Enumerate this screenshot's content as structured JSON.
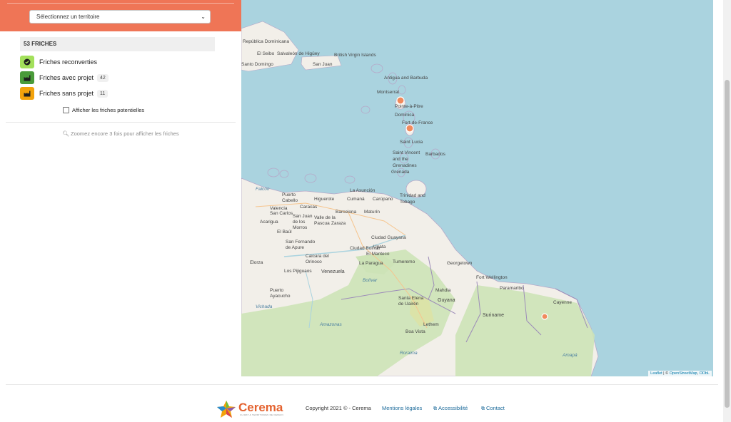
{
  "sidebar": {
    "territory_select": {
      "value": "Sélectionnez un territoire"
    },
    "count_header": "53 FRICHES",
    "legend": [
      {
        "label": "Friches reconverties",
        "badge": null,
        "color": "#a3e05b",
        "icon": "check-circle-icon"
      },
      {
        "label": "Friches avec projet",
        "badge": "42",
        "color": "#4a9b3a",
        "icon": "factory-icon"
      },
      {
        "label": "Friches sans projet",
        "badge": "11",
        "color": "#f2a20b",
        "icon": "factory-icon"
      }
    ],
    "potential_checkbox": {
      "label": "Afficher les friches potentielles",
      "checked": false
    },
    "zoom_message": "Zoomez encore 3 fois pour afficher les friches",
    "accent_color": "#ef7556"
  },
  "map": {
    "attribution": {
      "leaflet": "Leaflet",
      "separator": " | © ",
      "osm": "OpenStreetMap",
      "odbl": "ODbL"
    },
    "places": {
      "republica_dominicana": "República Dominicana",
      "el_seibo": "El Seibo",
      "salvaleon_de_higuey": "Salvaleón de Higüey",
      "santo_domingo": "Santo Domingo",
      "san_juan": "San Juan",
      "british_virgin_islands": "British Virgin Islands",
      "antigua_and_barbuda": "Antigua and Barbuda",
      "montserrat": "Montserrat",
      "pointe_a_pitre": "Pointe-à-Pitre",
      "dominica": "Dominica",
      "fort_de_france": "Fort-de-France",
      "saint_lucia": "Saint Lucia",
      "barbados": "Barbados",
      "saint_vincent": "Saint Vincent and the Grenadines",
      "grenada": "Grenada",
      "trinidad_and_tobago": "Trinidad and Tobago",
      "caracas": "Caracas",
      "valencia": "Valencia",
      "barcelona": "Barcelona",
      "maturin": "Maturín",
      "cumana": "Cumaná",
      "ciudad_guayana": "Ciudad Guayana",
      "ciudad_bolivar": "Ciudad Bolívar",
      "san_fernando_de_apure": "San Fernando de Apure",
      "georgetown": "Georgetown",
      "paramaribo": "Paramaribo",
      "cayenne": "Cayenne",
      "venezuela": "Venezuela",
      "guyana": "Guyana",
      "suriname": "Suriname",
      "boa_vista": "Boa Vista",
      "santa_elena_de_uairen": "Santa Elena de Uairén",
      "puerto_ayacucho": "Puerto Ayacucho",
      "lethem": "Lethem",
      "new_amsterdam": "New Amsterdam",
      "fort_wellington": "Fort Wellington",
      "linden": "Linden",
      "mahdia": "Mahdia",
      "la_asuncion": "La Asunción",
      "carupano": "Carúpano",
      "upata": "Upata",
      "el_manteco": "El Manteco",
      "la_paragua": "La Paragua",
      "tumeremo": "Tumeremo",
      "caicara_del_orinoco": "Caicara del Orinoco",
      "los_pijiguaos": "Los Pijiguaos",
      "elorza": "Elorza",
      "el_baul": "El Baúl",
      "acarigua": "Acarigua",
      "san_carlos": "San Carlos",
      "san_juan_de_los_morros": "San Juan de los Morros",
      "zaraza": "Zaraza",
      "valle_de_la_pascua": "Valle de la Pascua",
      "higuerote": "Higuerote",
      "puerto_cabello": "Puerto Cabello",
      "falcon": "Falcón",
      "amazonas": "Amazonas",
      "bolivar": "Bolívar",
      "roraima": "Roraima",
      "amapa": "Amapá",
      "vichada": "Vichada"
    }
  },
  "footer": {
    "logo_text": "Cerema",
    "logo_tagline": "CLIMAT & TERRITOIRES DE DEMAIN",
    "copyright": "Copyright 2021 © - Cerema",
    "links": {
      "mentions": "Mentions légales",
      "accessibility": "Accessibilité",
      "contact": "Contact"
    }
  }
}
